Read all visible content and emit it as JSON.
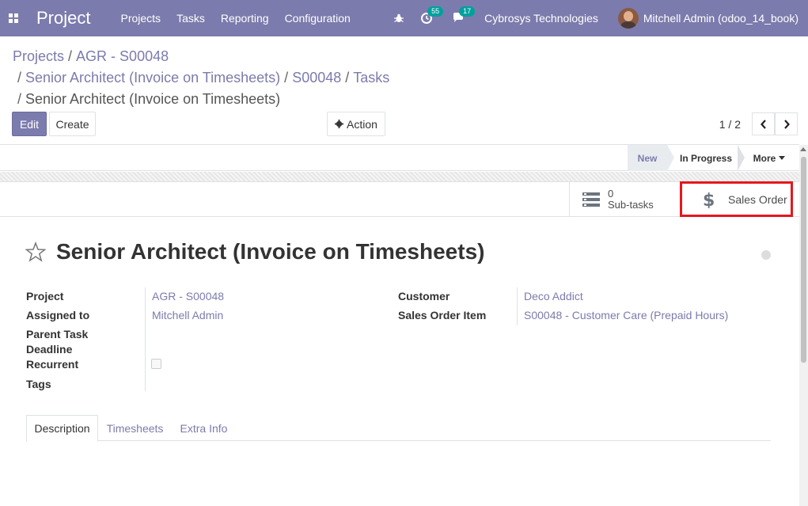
{
  "navbar": {
    "brand": "Project",
    "menu": [
      "Projects",
      "Tasks",
      "Reporting",
      "Configuration"
    ],
    "activity_count": "55",
    "messages_count": "17",
    "company": "Cybrosys Technologies",
    "user": "Mitchell Admin (odoo_14_book)",
    "bg_color": "#7c7bad"
  },
  "breadcrumb": {
    "items": [
      "Projects",
      "AGR - S00048",
      "Senior Architect (Invoice on Timesheets)",
      "S00048",
      "Tasks"
    ],
    "current": "Senior Architect (Invoice on Timesheets)",
    "separator": "/"
  },
  "control": {
    "edit_label": "Edit",
    "create_label": "Create",
    "action_label": "Action",
    "pager": "1 / 2"
  },
  "status": {
    "stages": [
      "New",
      "In Progress"
    ],
    "active_stage": "New",
    "more_label": "More"
  },
  "button_box": {
    "subtasks_count": "0",
    "subtasks_label": "Sub-tasks",
    "sales_order_label": "Sales Order"
  },
  "task": {
    "title": "Senior Architect (Invoice on Timesheets)",
    "fields_left": [
      {
        "label": "Project",
        "value": "AGR - S00048"
      },
      {
        "label": "Assigned to",
        "value": "Mitchell Admin"
      },
      {
        "label": "Parent Task",
        "value": ""
      },
      {
        "label": "Deadline",
        "value": ""
      },
      {
        "label": "Recurrent",
        "value": ""
      },
      {
        "label": "Tags",
        "value": ""
      }
    ],
    "fields_right": [
      {
        "label": "Customer",
        "value": "Deco Addict"
      },
      {
        "label": "Sales Order Item",
        "value": "S00048 - Customer Care (Prepaid Hours)"
      }
    ]
  },
  "tabs": [
    "Description",
    "Timesheets",
    "Extra Info"
  ],
  "active_tab": "Description",
  "highlight_color": "#e6171d"
}
